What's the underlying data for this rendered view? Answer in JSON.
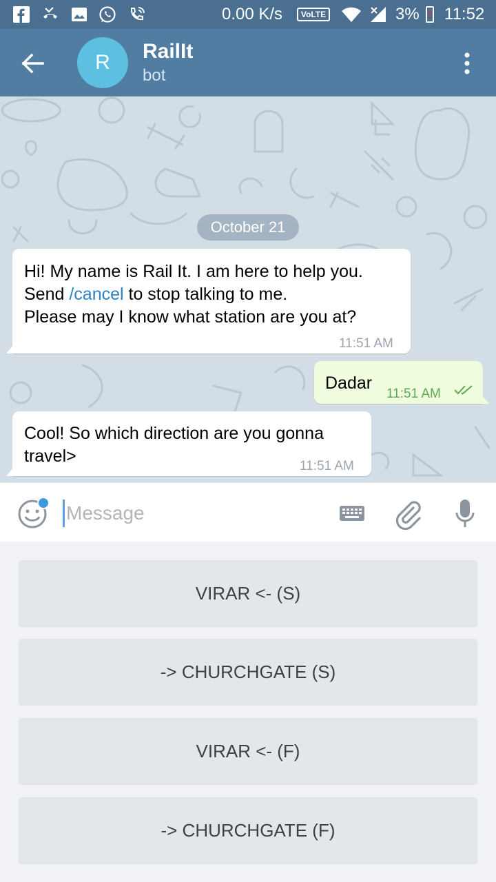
{
  "status_bar": {
    "network_speed": "0.00 K/s",
    "volte": "VoLTE",
    "battery": "3%",
    "time": "11:52",
    "icons": [
      "facebook-icon",
      "missed-call-icon",
      "image-icon",
      "whatsapp-icon",
      "wifi-call-icon",
      "wifi-icon",
      "signal-icon",
      "battery-icon"
    ]
  },
  "header": {
    "avatar_letter": "R",
    "title": "RailIt",
    "subtitle": "bot",
    "colors": {
      "bar": "#517da2",
      "avatar": "#5ec0e0"
    }
  },
  "chat": {
    "date": "October 21",
    "messages": [
      {
        "direction": "in",
        "line1": "Hi! My name is Rail It. I am here to help you.",
        "line2_before": "Send ",
        "line2_link": "/cancel",
        "line2_after": " to stop talking to me.",
        "line3": "Please may I know what station are you at?",
        "time": "11:51 AM"
      },
      {
        "direction": "out",
        "text": "Dadar",
        "time": "11:51 AM",
        "status": "read"
      },
      {
        "direction": "in",
        "line1": "Cool! So which direction are you gonna",
        "line2": "travel>",
        "time": "11:51 AM"
      }
    ]
  },
  "composer": {
    "placeholder": "Message"
  },
  "bot_keyboard": {
    "buttons": [
      {
        "label": "VIRAR <- (S)"
      },
      {
        "label": "-> CHURCHGATE (S)"
      },
      {
        "label": "VIRAR <- (F)"
      },
      {
        "label": "-> CHURCHGATE (F)"
      }
    ]
  }
}
